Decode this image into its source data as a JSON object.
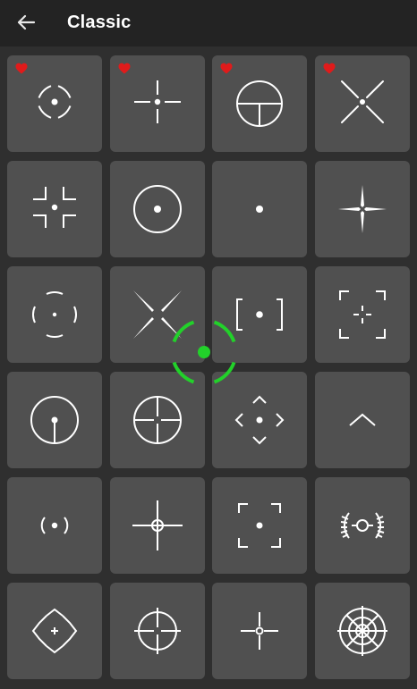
{
  "header": {
    "title": "Classic",
    "back_icon": "arrow-left-icon"
  },
  "colors": {
    "header_bg": "#232323",
    "tile_bg": "#505050",
    "favorite": "#e01b1b",
    "active_crosshair": "#22d12a",
    "icon_stroke": "#ffffff"
  },
  "tiles": [
    {
      "icon": "crosshair-dashed-ring-dot-icon",
      "favorite": true
    },
    {
      "icon": "crosshair-gap-cross-dot-icon",
      "favorite": true
    },
    {
      "icon": "crosshair-circle-t-icon",
      "favorite": true
    },
    {
      "icon": "crosshair-x-spikes-dot-icon",
      "favorite": true
    },
    {
      "icon": "crosshair-four-corners-dot-icon",
      "favorite": false
    },
    {
      "icon": "crosshair-circle-dot-icon",
      "favorite": false
    },
    {
      "icon": "crosshair-dot-icon",
      "favorite": false
    },
    {
      "icon": "crosshair-thin-spikes-icon",
      "favorite": false
    },
    {
      "icon": "crosshair-arc-segments-dot-icon",
      "favorite": false
    },
    {
      "icon": "crosshair-x-spikes-icon",
      "favorite": false
    },
    {
      "icon": "crosshair-square-brackets-dot-icon",
      "favorite": false
    },
    {
      "icon": "crosshair-corner-frame-cross-icon",
      "favorite": false
    },
    {
      "icon": "crosshair-circle-stem-dot-icon",
      "favorite": false
    },
    {
      "icon": "crosshair-circle-cross-icon",
      "favorite": false
    },
    {
      "icon": "crosshair-diamond-chevrons-dot-icon",
      "favorite": false
    },
    {
      "icon": "crosshair-chevron-up-icon",
      "favorite": false
    },
    {
      "icon": "crosshair-parentheses-dot-icon",
      "favorite": false
    },
    {
      "icon": "crosshair-cross-small-circle-icon",
      "favorite": false
    },
    {
      "icon": "crosshair-corner-frame-dot-icon",
      "favorite": false
    },
    {
      "icon": "crosshair-ribbed-arcs-ring-icon",
      "favorite": false
    },
    {
      "icon": "crosshair-broken-diamond-cross-icon",
      "favorite": false
    },
    {
      "icon": "crosshair-circle-long-cross-icon",
      "favorite": false
    },
    {
      "icon": "crosshair-bold-cross-ring-icon",
      "favorite": false
    },
    {
      "icon": "crosshair-sniper-scope-icon",
      "favorite": false
    }
  ],
  "active_overlay": {
    "icon": "crosshair-active-green-ring-dot-icon"
  }
}
